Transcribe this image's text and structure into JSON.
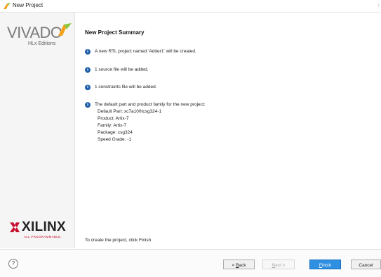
{
  "window": {
    "title": "New Project"
  },
  "branding": {
    "product": "VIVADO",
    "edition": "HLx Editions",
    "vendor": "XILINX",
    "vendor_tagline": "ALL PROGRAMMABLE.",
    "colors": {
      "vivado_leaf": "#f4a11c",
      "vivado_leaf_green": "#8dc63f",
      "xilinx_red": "#c8102e"
    }
  },
  "summary": {
    "heading": "New Project Summary",
    "items": [
      {
        "text": "A new RTL project named 'Adder1' will be created."
      },
      {
        "text": "1 source file will be added."
      },
      {
        "text": "1 constraints file will be added."
      }
    ],
    "part_info": {
      "intro": "The default part and product family for the new project:",
      "default_part": "Default Part: xc7a100tcsg324-1",
      "product": "Product: Artix-7",
      "family": "Family: Artix-7",
      "package": "Package: csg324",
      "speed_grade": "Speed Grade: -1"
    },
    "footer_hint": "To create the project, click Finish"
  },
  "buttons": {
    "help": "?",
    "back": {
      "prefix": "< ",
      "accel": "B",
      "rest": "ack"
    },
    "next": {
      "accel": "N",
      "rest": "ext >"
    },
    "finish": {
      "accel": "F",
      "rest": "inish"
    },
    "cancel": "Cancel"
  },
  "colors": {
    "accent": "#2f8fe0",
    "info_icon": "#1f5fa8"
  }
}
